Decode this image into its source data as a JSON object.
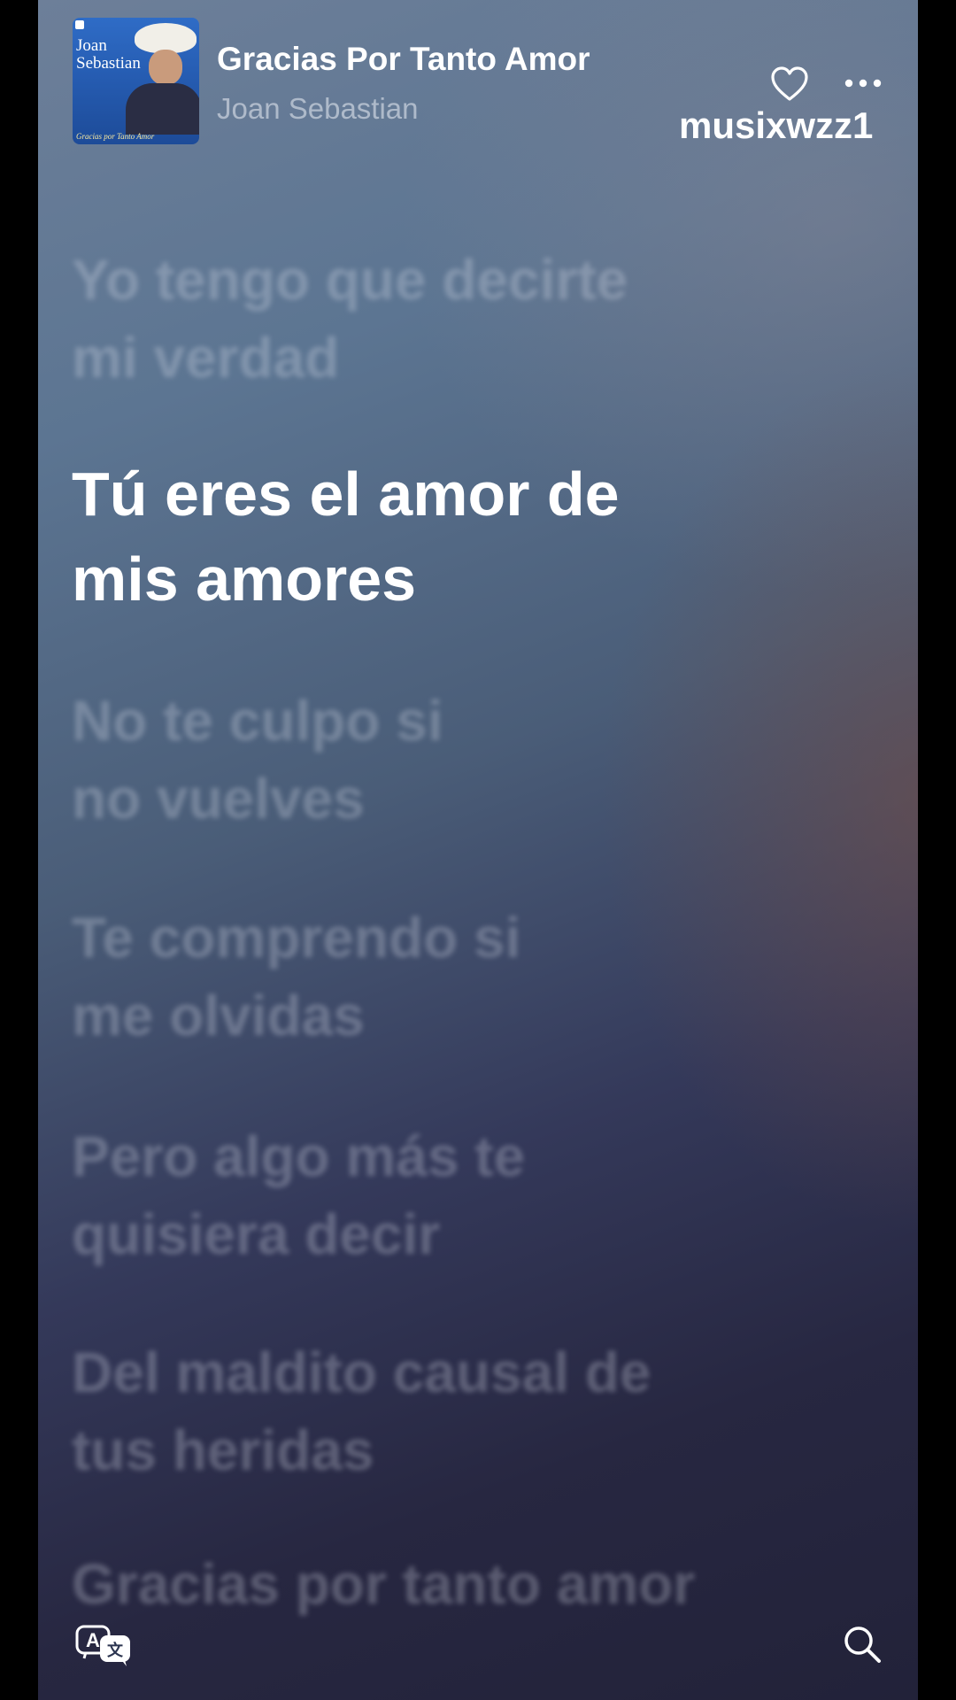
{
  "now_playing": {
    "title": "Gracias Por Tanto Amor",
    "artist": "Joan Sebastian",
    "album_art": {
      "name_text": "Joan Sebastian",
      "caption": "Gracias por Tanto Amor"
    }
  },
  "watermark": "musixwzz1",
  "lyrics": [
    {
      "lines": [
        "Yo tengo que decirte",
        "mi verdad"
      ],
      "active": false
    },
    {
      "lines": [
        "Tú eres el amor de",
        "mis amores"
      ],
      "active": true
    },
    {
      "lines": [
        "No te culpo si",
        "no vuelves"
      ],
      "active": false
    },
    {
      "lines": [
        "Te comprendo si",
        "me olvidas"
      ],
      "active": false
    },
    {
      "lines": [
        "Pero algo más te",
        "quisiera decir"
      ],
      "active": false
    },
    {
      "lines": [
        "Del maldito causal de",
        "tus heridas"
      ],
      "active": false
    },
    {
      "lines": [
        "Gracias por tanto amor",
        ""
      ],
      "active": false
    }
  ],
  "icons": {
    "favorite": "heart-icon",
    "more": "ellipsis-icon",
    "translate": "translate-icon",
    "search": "search-icon"
  }
}
